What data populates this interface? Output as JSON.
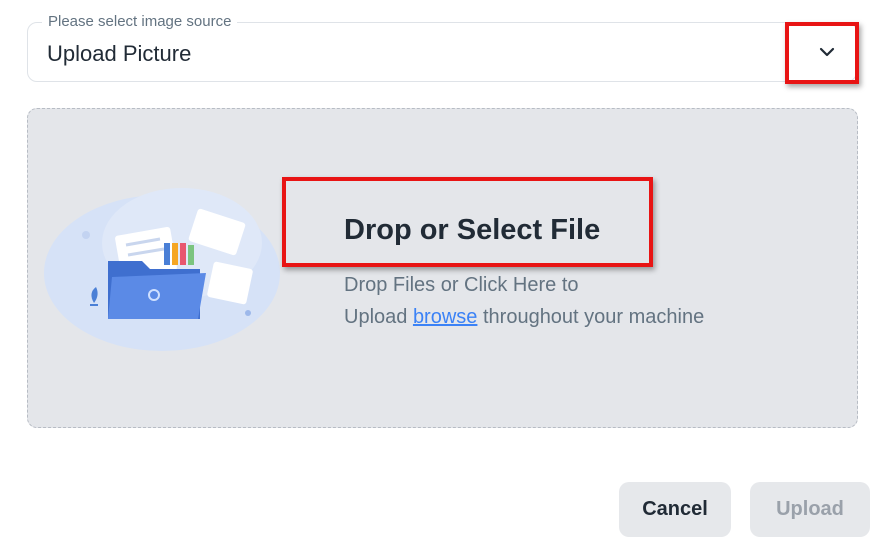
{
  "image_source": {
    "legend": "Please select image source",
    "selected": "Upload Picture"
  },
  "dropzone": {
    "title": "Drop or Select File",
    "line1": "Drop Files or Click Here to",
    "line2_prefix": "Upload ",
    "browse_link": "browse",
    "line2_suffix": " throughout your machine"
  },
  "actions": {
    "cancel_label": "Cancel",
    "upload_label": "Upload"
  },
  "colors": {
    "annotation": "#e81414",
    "link": "#3b82f6"
  }
}
